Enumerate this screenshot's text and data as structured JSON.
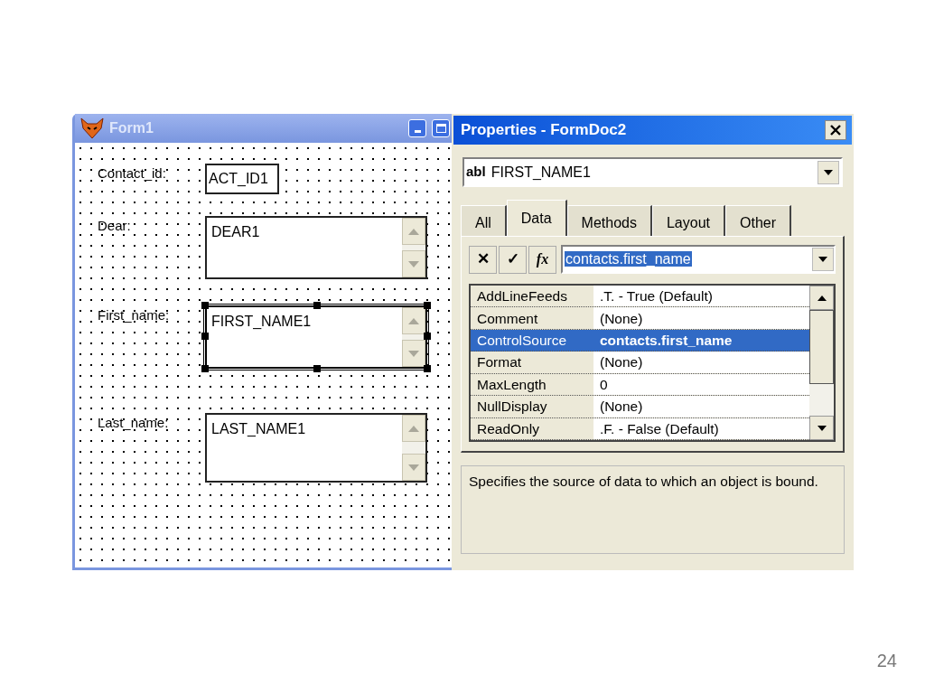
{
  "form_window": {
    "title": "Form1",
    "fields": [
      {
        "label": "Contact_id:",
        "value": "ACT_ID1",
        "kind": "textbox",
        "selected": false
      },
      {
        "label": "Dear:",
        "value": "DEAR1",
        "kind": "editbox",
        "selected": false
      },
      {
        "label": "First_name:",
        "value": "FIRST_NAME1",
        "kind": "editbox",
        "selected": true
      },
      {
        "label": "Last_name:",
        "value": "LAST_NAME1",
        "kind": "editbox",
        "selected": false
      }
    ]
  },
  "properties_window": {
    "title": "Properties - FormDoc2",
    "object_combo": {
      "prefix": "abl",
      "value": "FIRST_NAME1"
    },
    "tabs": [
      {
        "label": "All",
        "selected": false
      },
      {
        "label": "Data",
        "selected": true
      },
      {
        "label": "Methods",
        "selected": false
      },
      {
        "label": "Layout",
        "selected": false
      },
      {
        "label": "Other",
        "selected": false
      }
    ],
    "toolbar": {
      "cancel": "✕",
      "accept": "✓",
      "function": "fx"
    },
    "value_field": {
      "value": "contacts.first_name"
    },
    "properties": [
      {
        "name": "AddLineFeeds",
        "value": ".T. - True (Default)",
        "selected": false
      },
      {
        "name": "Comment",
        "value": "(None)",
        "selected": false
      },
      {
        "name": "ControlSource",
        "value": "contacts.first_name",
        "selected": true
      },
      {
        "name": "Format",
        "value": "(None)",
        "selected": false
      },
      {
        "name": "MaxLength",
        "value": "0",
        "selected": false
      },
      {
        "name": "NullDisplay",
        "value": "(None)",
        "selected": false
      },
      {
        "name": "ReadOnly",
        "value": ".F. - False (Default)",
        "selected": false
      }
    ],
    "description": "Specifies the source of data to which an object is bound."
  },
  "slide": {
    "page_number": "24"
  }
}
